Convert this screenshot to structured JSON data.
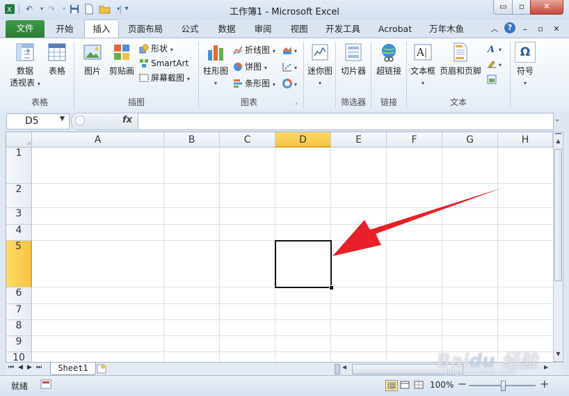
{
  "window": {
    "title": "工作簿1 - Microsoft Excel",
    "min_glyph": "▭",
    "restore_glyph": "▫",
    "close_glyph": "✕"
  },
  "qat": {
    "separator": "|",
    "customize": "▾"
  },
  "tabs": [
    "文件",
    "开始",
    "插入",
    "页面布局",
    "公式",
    "数据",
    "审阅",
    "视图",
    "开发工具",
    "Acrobat",
    "万年木鱼"
  ],
  "active_tab": "插入",
  "ribbon": {
    "groups": {
      "tables": "表格",
      "illustrations": "插图",
      "charts": "图表",
      "sparklines": "",
      "filter": "筛选器",
      "links": "链接",
      "text": "文本"
    },
    "buttons": {
      "pivot_table_line1": "数据",
      "pivot_table_line2": "透视表",
      "table": "表格",
      "picture": "图片",
      "clipart": "剪贴画",
      "shapes": "形状",
      "smartart": "SmartArt",
      "screenshot": "屏幕截图",
      "column_chart": "柱形图",
      "line_chart": "折线图",
      "pie_chart": "饼图",
      "bar_chart": "条形图",
      "sparkline": "迷你图",
      "slicer": "切片器",
      "hyperlink": "超链接",
      "textbox": "文本框",
      "header_footer": "页眉和页脚",
      "symbol": "符号"
    }
  },
  "formula_bar": {
    "name_box": "D5",
    "fx": "fx",
    "value": ""
  },
  "grid": {
    "columns": [
      "A",
      "B",
      "C",
      "D",
      "E",
      "F",
      "G",
      "H"
    ],
    "rows": [
      "1",
      "2",
      "3",
      "4",
      "5",
      "6",
      "7",
      "8",
      "9",
      "10"
    ],
    "selected_cell": "D5"
  },
  "sheets": [
    "Sheet1"
  ],
  "status": {
    "ready": "就绪",
    "zoom": "100%",
    "zoom_minus": "−",
    "zoom_plus": "+"
  },
  "colors": {
    "file_tab": "#2c7b35",
    "selection_header": "#ffd966",
    "arrow": "#e8202a"
  }
}
